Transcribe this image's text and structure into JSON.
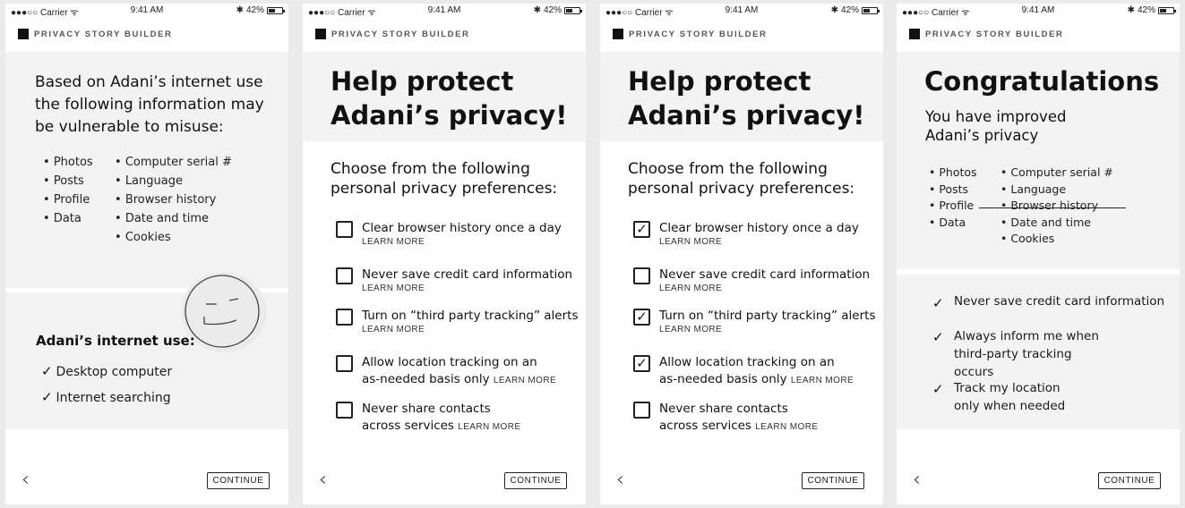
{
  "status": {
    "carrier": "●●●○○ Carrier",
    "wifi_icon": "wifi-icon",
    "time": "9:41 AM",
    "bluetooth_icon": "bluetooth-icon",
    "battery_percent": "42%",
    "battery_level": 0.42
  },
  "app": {
    "name": "PRIVACY STORY BUILDER"
  },
  "nav": {
    "back": "‹",
    "continue": "CONTINUE"
  },
  "screen1": {
    "intro": "Based on Adani’s internet use the following information may be vulnerable to misuse:",
    "info_col1": [
      "Photos",
      "Posts",
      "Profile",
      "Data"
    ],
    "info_col2": [
      "Computer serial #",
      "Language",
      "Browser history",
      "Date and time",
      "Cookies"
    ],
    "usage_title": "Adani’s internet use:",
    "usage": [
      "Desktop computer",
      "Internet searching"
    ]
  },
  "protect": {
    "title_line1": "Help protect",
    "title_line2": "Adani’s privacy!",
    "choose": "Choose from the following personal privacy preferences:",
    "learn_more": "LEARN MORE",
    "options": [
      "Clear browser history once a day",
      "Never save credit card information",
      "Turn on “third party tracking” alerts",
      "Allow location tracking on an as-needed basis only",
      "Never share contacts across services"
    ]
  },
  "screen2": {
    "checked": [
      false,
      false,
      false,
      false,
      false
    ]
  },
  "screen3": {
    "checked": [
      true,
      false,
      true,
      true,
      false
    ]
  },
  "screen4": {
    "title": "Congratulations",
    "subtitle": "You have improved Adani’s privacy",
    "info_col1": [
      "Photos",
      "Posts",
      "Profile",
      "Data"
    ],
    "info_col2": [
      "Computer serial #",
      "Language",
      "Browser history",
      "Date and time",
      "Cookies"
    ],
    "improvements": [
      "Never save credit card information",
      "Always inform me when third-party tracking occurs",
      "Track my location only when needed"
    ]
  }
}
